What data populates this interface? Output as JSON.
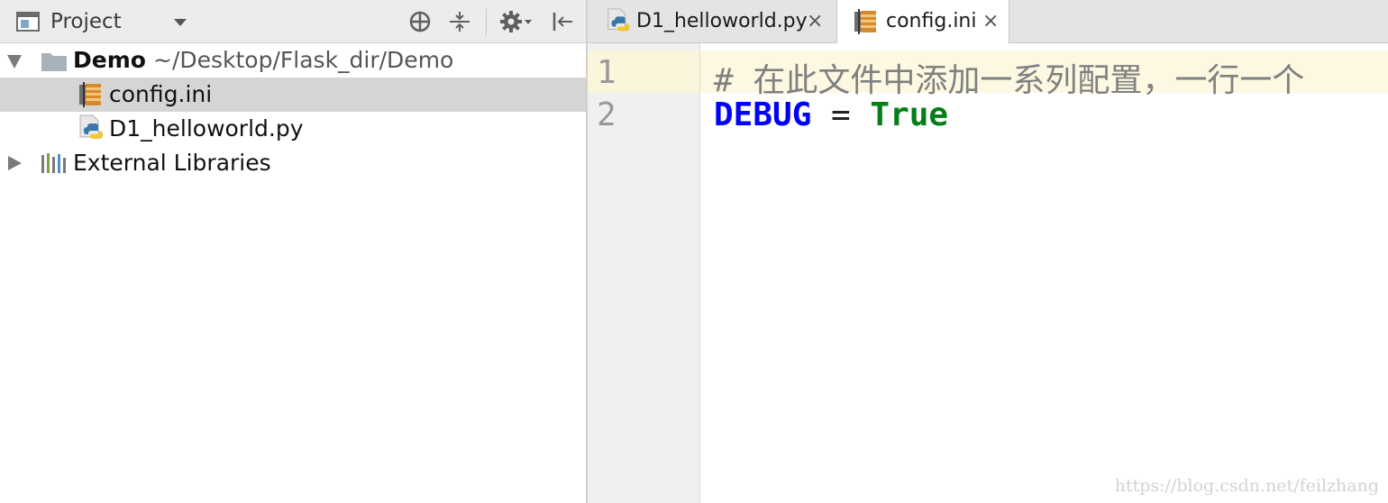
{
  "project_panel": {
    "selector_label": "Project",
    "icons": {
      "selector": "project-view-icon",
      "locate": "crosshair-icon",
      "collapse": "collapse-all-icon",
      "settings": "gear-icon",
      "hide": "hide-panel-icon"
    },
    "tree": [
      {
        "label": "Demo",
        "path": "~/Desktop/Flask_dir/Demo",
        "icon": "folder-icon",
        "expanded": true
      },
      {
        "label": "config.ini",
        "icon": "ini-file-icon",
        "selected": true
      },
      {
        "label": "D1_helloworld.py",
        "icon": "python-file-icon"
      },
      {
        "label": "External Libraries",
        "icon": "libraries-icon",
        "expanded": false
      }
    ]
  },
  "editor": {
    "tabs": [
      {
        "label": "D1_helloworld.py",
        "icon": "python-file-icon",
        "close": "×",
        "active": false
      },
      {
        "label": "config.ini",
        "icon": "ini-file-icon",
        "close": "×",
        "active": true
      }
    ],
    "lines": [
      {
        "number": "1",
        "text": "# 在此文件中添加一系列配置，一行一个"
      },
      {
        "number": "2",
        "key": "DEBUG",
        "op": " = ",
        "value": "True"
      }
    ]
  },
  "watermark": "https://blog.csdn.net/feilzhang",
  "colors": {
    "keyword": "#0000ff",
    "value": "#067d17",
    "comment": "#808080",
    "selection": "#d5d5d5",
    "current_line": "#fdf8e1"
  }
}
